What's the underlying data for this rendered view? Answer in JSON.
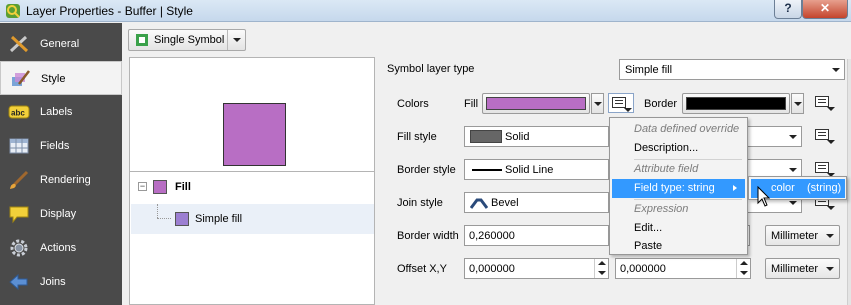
{
  "window": {
    "title": "Layer Properties - Buffer | Style",
    "help_label": "?",
    "close_label": "✕"
  },
  "sidebar": {
    "items": [
      {
        "label": "General",
        "icon": "wrench-icon"
      },
      {
        "label": "Style",
        "icon": "paintbrush-icon",
        "active": true
      },
      {
        "label": "Labels",
        "icon": "abc-label-icon"
      },
      {
        "label": "Fields",
        "icon": "table-icon"
      },
      {
        "label": "Rendering",
        "icon": "brush-icon"
      },
      {
        "label": "Display",
        "icon": "speech-bubble-icon"
      },
      {
        "label": "Actions",
        "icon": "gear-icon"
      },
      {
        "label": "Joins",
        "icon": "join-arrow-icon"
      }
    ]
  },
  "renderer": {
    "type_label": "Single Symbol"
  },
  "symbol_tree": {
    "root": "Fill",
    "child": "Simple fill"
  },
  "form": {
    "symbol_layer_type_label": "Symbol layer type",
    "symbol_layer_type_value": "Simple fill",
    "colors_label": "Colors",
    "fill_label": "Fill",
    "fill_color": "#b86ec4",
    "border_label": "Border",
    "border_color": "#000000",
    "fill_style_label": "Fill style",
    "fill_style_value": "Solid",
    "border_style_label": "Border style",
    "border_style_value": "Solid Line",
    "join_style_label": "Join style",
    "join_style_value": "Bevel",
    "border_width_label": "Border width",
    "border_width_value": "0,260000",
    "border_width_unit": "Millimeter",
    "offset_label": "Offset X,Y",
    "offset_x": "0,000000",
    "offset_y": "0,000000",
    "offset_unit": "Millimeter"
  },
  "context_menu": {
    "items": [
      {
        "label": "Data defined override",
        "kind": "header"
      },
      {
        "label": "Description...",
        "kind": "item"
      },
      {
        "label": "Attribute field",
        "kind": "header"
      },
      {
        "label": "Field type: string",
        "kind": "submenu",
        "highlighted": true
      },
      {
        "label": "Expression",
        "kind": "header"
      },
      {
        "label": "Edit...",
        "kind": "item"
      },
      {
        "label": "Paste",
        "kind": "item"
      }
    ]
  },
  "submenu": {
    "field": "color",
    "type": "(string)"
  }
}
